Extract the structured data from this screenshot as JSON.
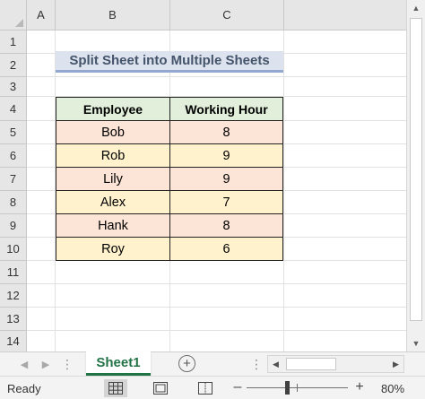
{
  "spreadsheet": {
    "columns": [
      "A",
      "B",
      "C"
    ],
    "rows": [
      "1",
      "2",
      "3",
      "4",
      "5",
      "6",
      "7",
      "8",
      "9",
      "10",
      "11",
      "12",
      "13",
      "14"
    ],
    "title": "Split Sheet into Multiple Sheets",
    "table": {
      "headers": [
        "Employee",
        "Working Hour"
      ],
      "rows": [
        [
          "Bob",
          "8"
        ],
        [
          "Rob",
          "9"
        ],
        [
          "Lily",
          "9"
        ],
        [
          "Alex",
          "7"
        ],
        [
          "Hank",
          "8"
        ],
        [
          "Roy",
          "6"
        ]
      ]
    }
  },
  "tabs": {
    "sheets": [
      "Sheet1"
    ],
    "active": "Sheet1",
    "add_icon": "plus-circle-icon",
    "more_icon": "ellipsis-icon"
  },
  "status": {
    "text": "Ready",
    "zoom": "80%",
    "zoom_value": 80
  },
  "colors": {
    "accent": "#217346",
    "title_bg": "#dce3ee",
    "title_border": "#93a8cf",
    "header_bg": "#e2efda",
    "row_odd": "#fce4d6",
    "row_even": "#fff2cc"
  }
}
